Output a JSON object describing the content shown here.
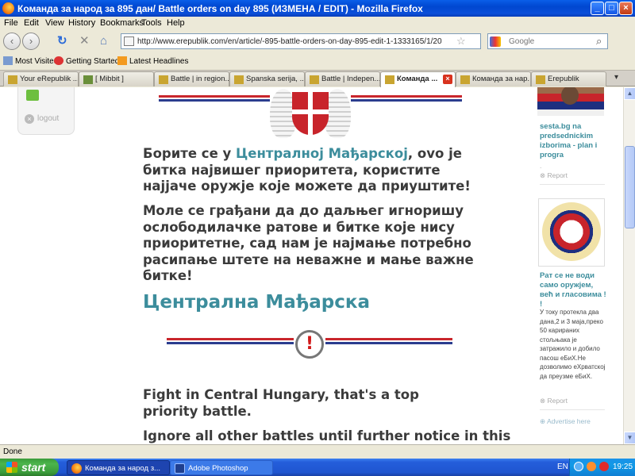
{
  "window": {
    "title": "Команда за народ за 895 дан/ Battle orders on day 895 (ИЗМЕНА / EDIT) - Mozilla Firefox",
    "min_label": "_",
    "max_label": "□",
    "close_label": "×"
  },
  "menu": {
    "items": [
      "File",
      "Edit",
      "View",
      "History",
      "Bookmarks",
      "Tools",
      "Help"
    ]
  },
  "nav": {
    "url": "http://www.erepublik.com/en/article/-895-battle-orders-on-day-895-edit-1-1333165/1/20",
    "search_placeholder": "Google",
    "back_glyph": "‹",
    "forward_glyph": "›",
    "reload_glyph": "↻",
    "stop_glyph": "✕",
    "home_glyph": "⌂",
    "star_glyph": "☆",
    "search_glyph": "⌕"
  },
  "bookmarks": {
    "items": [
      "Most Visited",
      "Getting Started",
      "Latest Headlines"
    ]
  },
  "tabs": {
    "items": [
      {
        "label": "Your eRepublik ..."
      },
      {
        "label": "[ Mibbit ]"
      },
      {
        "label": "Battle | in region..."
      },
      {
        "label": "Spanska serija, ..."
      },
      {
        "label": "Battle | Indepen..."
      },
      {
        "label": "Команда ..."
      },
      {
        "label": "Команда за нар..."
      },
      {
        "label": "Erepublik"
      }
    ],
    "active_index": 5,
    "list_glyph": "▾"
  },
  "left_panel": {
    "logout": "logout"
  },
  "article": {
    "p1_pre": "Борите се у ",
    "p1_link": "Централној Мађарској",
    "p1_post": ", ovo je битка највишег приоритета, користите најјаче оружје које можете да приуштите!",
    "p2": "Моле се грађани да до даљњег игноришу ослободилачке ратове и битке које нису приоритетне, сад нам је најмање потребно расипање штете на неважне и мање важне битке!",
    "heading": "Централна Мађарска",
    "alert_glyph": "!",
    "p3": "Fight in Central Hungary, that's a top priority battle.",
    "p4": "Ignore all other battles until further notice in this"
  },
  "sidebar": {
    "ad1_title": "sesta.bg na predsednickim izborima - plan i progra",
    "ad1_dot": ".",
    "report_label": "Report",
    "ad2_title": "Рат се не води само оружјем, већ и гласовима ! !",
    "ad2_text": "У току протекла два дана,2 и 3 маја,преко 50 карираних стољњака је затражило и добило пасош еБиХ.Не дозволимо еХрватској да преузме еБиХ.",
    "advertise": "Advertise here"
  },
  "status": {
    "text": "Done"
  },
  "taskbar": {
    "start": "start",
    "items": [
      "Команда за народ з...",
      "Adobe Photoshop"
    ],
    "lang": "EN",
    "time": "19:25"
  }
}
